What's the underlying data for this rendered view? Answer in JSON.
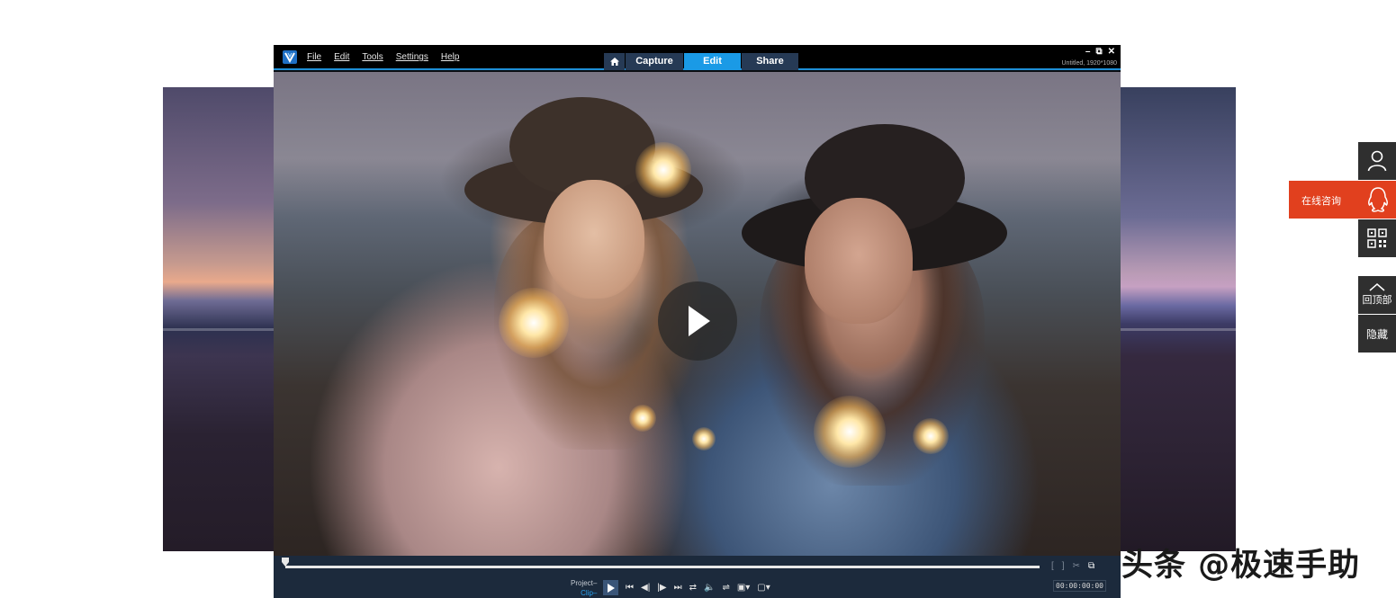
{
  "app": {
    "menu": [
      {
        "label": "File"
      },
      {
        "label": "Edit"
      },
      {
        "label": "Tools"
      },
      {
        "label": "Settings"
      },
      {
        "label": "Help"
      }
    ],
    "tabs": {
      "capture": "Capture",
      "edit": "Edit",
      "share": "Share",
      "active": "Edit"
    },
    "window_controls": {
      "minimize": "–",
      "restore": "⧉",
      "close": "✕"
    },
    "project_info": "Untitled, 1920*1080",
    "player": {
      "mode_project": "Project",
      "mode_clip": "Clip",
      "active_mode": "Clip",
      "timecode": "00:00:00:00",
      "progress": 0,
      "transport_icons": [
        "play-icon",
        "go-to-start-icon",
        "previous-frame-icon",
        "next-frame-icon",
        "go-to-end-icon",
        "repeat-icon",
        "volume-icon",
        "hd-preview-icon",
        "display-mode-icon",
        "snapshot-icon"
      ],
      "right_tool_icons": [
        "mark-in-icon",
        "mark-out-icon",
        "split-clip-icon",
        "enlarge-preview-icon"
      ]
    }
  },
  "sidebar": {
    "consult_label": "在线咨询",
    "back_to_top_label": "回顶部",
    "hide_label": "隐藏"
  },
  "watermark": "头条 @极速手助",
  "colors": {
    "accent": "#1a9ae6",
    "consult_bg": "#e1401e",
    "float_bg": "#2f2f2f",
    "controls_bg": "#1c2a3c"
  }
}
